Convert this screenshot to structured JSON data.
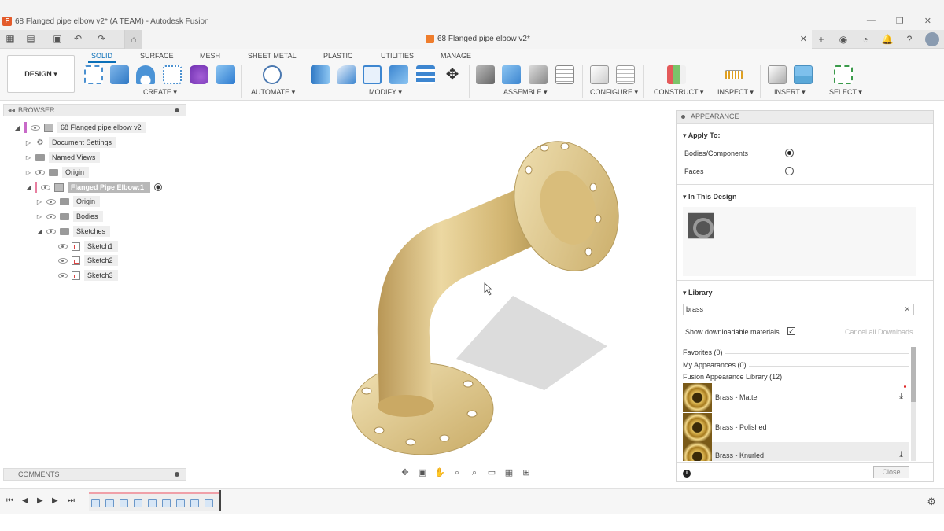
{
  "window": {
    "title": "68 Flanged pipe elbow v2* (A TEAM) - Autodesk Fusion",
    "controls": [
      "—",
      "❐",
      "✕"
    ]
  },
  "document_tab": {
    "title": "68 Flanged pipe elbow v2*",
    "close": "✕"
  },
  "ribbon": {
    "workspace": "DESIGN ▾",
    "tabs": [
      "SOLID",
      "SURFACE",
      "MESH",
      "SHEET METAL",
      "PLASTIC",
      "UTILITIES",
      "MANAGE"
    ],
    "active_tab": "SOLID",
    "groups": [
      "CREATE ▾",
      "AUTOMATE ▾",
      "MODIFY ▾",
      "ASSEMBLE ▾",
      "CONFIGURE ▾",
      "CONSTRUCT ▾",
      "INSPECT ▾",
      "INSERT ▾",
      "SELECT ▾"
    ]
  },
  "browser": {
    "header": "BROWSER",
    "items": [
      {
        "label": "68 Flanged pipe elbow v2"
      },
      {
        "label": "Document Settings"
      },
      {
        "label": "Named Views"
      },
      {
        "label": "Origin"
      },
      {
        "label": "Flanged Pipe Elbow:1"
      },
      {
        "label": "Origin"
      },
      {
        "label": "Bodies"
      },
      {
        "label": "Sketches"
      },
      {
        "label": "Sketch1"
      },
      {
        "label": "Sketch2"
      },
      {
        "label": "Sketch3"
      }
    ]
  },
  "comments": {
    "header": "COMMENTS"
  },
  "appearance": {
    "header": "APPEARANCE",
    "apply_to": {
      "title": "Apply To:",
      "options": [
        {
          "label": "Bodies/Components",
          "selected": true
        },
        {
          "label": "Faces",
          "selected": false
        }
      ]
    },
    "in_this_design": {
      "title": "In This Design"
    },
    "library": {
      "title": "Library",
      "search_value": "brass",
      "search_clear": "✕",
      "show_downloadable_label": "Show downloadable materials",
      "show_downloadable_checked": true,
      "check_mark": "✓",
      "cancel_downloads": "Cancel all Downloads",
      "favorites": "Favorites (0)",
      "my_appearances": "My Appearances (0)",
      "fusion_library": "Fusion Appearance Library (12)",
      "materials": [
        {
          "name": "Brass - Matte",
          "download": "⤓"
        },
        {
          "name": "Brass - Polished",
          "download": ""
        },
        {
          "name": "Brass - Knurled",
          "download": "⤓"
        }
      ]
    },
    "info_glyph": "i",
    "close_label": "Close"
  },
  "timeline": {
    "controls": [
      "⏮",
      "◀",
      "▶",
      "▶",
      "⏭"
    ]
  },
  "colors": {
    "accent": "#0a6fb8",
    "brass_light": "#ecd8a2",
    "brass_mid": "#d2b571",
    "brass_dark": "#a88a48",
    "shadow": "#d9d9d9"
  }
}
